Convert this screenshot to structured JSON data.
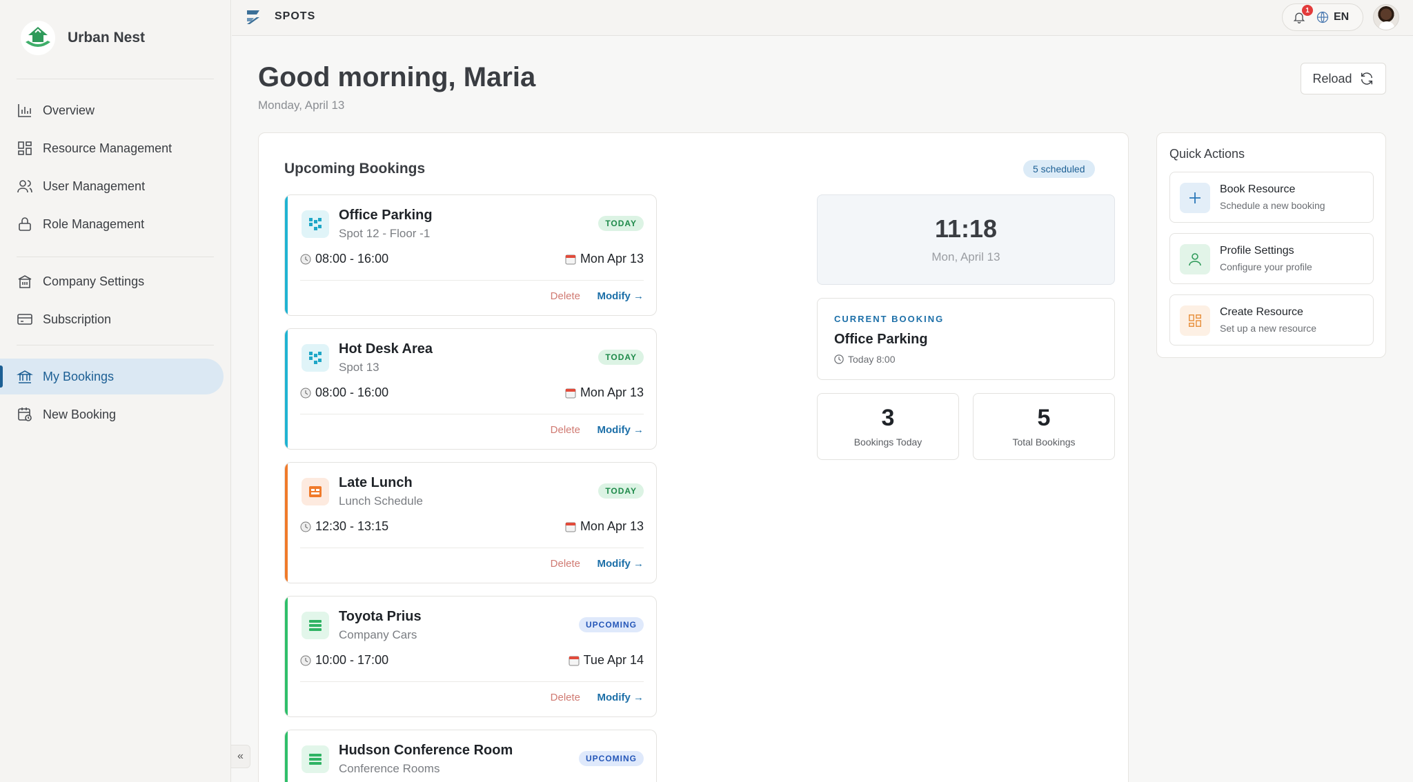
{
  "brand": {
    "name": "Urban Nest"
  },
  "app": {
    "name": "SPOTS"
  },
  "topbar": {
    "notification_count": "1",
    "language": "EN"
  },
  "sidebar": {
    "items": [
      {
        "label": "Overview",
        "icon": "chart-icon"
      },
      {
        "label": "Resource Management",
        "icon": "grid-icon"
      },
      {
        "label": "User Management",
        "icon": "users-icon"
      },
      {
        "label": "Role Management",
        "icon": "lock-icon"
      },
      {
        "label": "Company Settings",
        "icon": "building-icon"
      },
      {
        "label": "Subscription",
        "icon": "card-icon"
      },
      {
        "label": "My Bookings",
        "icon": "bank-icon",
        "active": true
      },
      {
        "label": "New Booking",
        "icon": "calendar-clock-icon"
      }
    ],
    "collapse_label": "«"
  },
  "header": {
    "greeting": "Good morning, Maria",
    "date": "Monday, April 13",
    "reload_label": "Reload"
  },
  "bookings": {
    "title": "Upcoming Bookings",
    "count_label": "5 scheduled",
    "delete_label": "Delete",
    "modify_label": "Modify →",
    "items": [
      {
        "title": "Office Parking",
        "subtitle": "Spot 12 - Floor -1",
        "status": "TODAY",
        "time": "08:00 - 16:00",
        "day": "Mon Apr 13",
        "accent": "#1fb3d2",
        "icon": "parking-grid-icon"
      },
      {
        "title": "Hot Desk Area",
        "subtitle": "Spot 13",
        "status": "TODAY",
        "time": "08:00 - 16:00",
        "day": "Mon Apr 13",
        "accent": "#1fb3d2",
        "icon": "desk-grid-icon"
      },
      {
        "title": "Late Lunch",
        "subtitle": "Lunch Schedule",
        "status": "TODAY",
        "time": "12:30 - 13:15",
        "day": "Mon Apr 13",
        "accent": "#f07a2a",
        "icon": "lunch-icon"
      },
      {
        "title": "Toyota Prius",
        "subtitle": "Company Cars",
        "status": "UPCOMING",
        "time": "10:00 - 17:00",
        "day": "Tue Apr 14",
        "accent": "#2fbf6a",
        "icon": "car-list-icon"
      },
      {
        "title": "Hudson Conference Room",
        "subtitle": "Conference Rooms",
        "status": "UPCOMING",
        "time": "",
        "day": "",
        "accent": "#2fbf6a",
        "icon": "room-list-icon"
      }
    ]
  },
  "clock": {
    "time": "11:18",
    "date": "Mon, April 13"
  },
  "current_booking": {
    "label": "CURRENT BOOKING",
    "title": "Office Parking",
    "time": "Today 8:00"
  },
  "stats": [
    {
      "value": "3",
      "label": "Bookings Today"
    },
    {
      "value": "5",
      "label": "Total Bookings"
    }
  ],
  "quick_actions": {
    "title": "Quick Actions",
    "items": [
      {
        "name": "Book Resource",
        "desc": "Schedule a new booking",
        "icon": "plus-icon"
      },
      {
        "name": "Profile Settings",
        "desc": "Configure your profile",
        "icon": "person-icon"
      },
      {
        "name": "Create Resource",
        "desc": "Set up a new resource",
        "icon": "grid-icon"
      }
    ]
  }
}
